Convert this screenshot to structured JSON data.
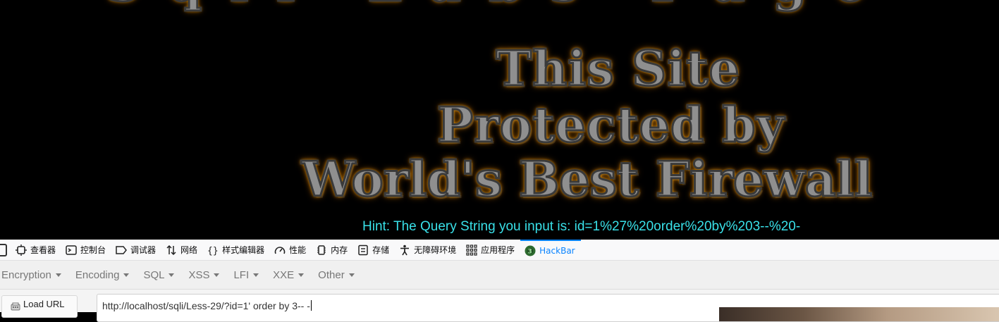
{
  "page": {
    "banner": {
      "top_partial": "Sqli Labs Page",
      "line1": "This Site",
      "line2": "Protected by",
      "line3": "World's Best Firewall"
    },
    "hint": "Hint: The Query String you input is: id=1%27%20order%20by%203--%20-"
  },
  "devtools": {
    "tabs": [
      {
        "label": "查看器",
        "icon": "inspector-icon"
      },
      {
        "label": "控制台",
        "icon": "console-icon"
      },
      {
        "label": "调试器",
        "icon": "debugger-icon"
      },
      {
        "label": "网络",
        "icon": "network-icon"
      },
      {
        "label": "样式编辑器",
        "icon": "style-editor-icon"
      },
      {
        "label": "性能",
        "icon": "performance-icon"
      },
      {
        "label": "内存",
        "icon": "memory-icon"
      },
      {
        "label": "存储",
        "icon": "storage-icon"
      },
      {
        "label": "无障碍环境",
        "icon": "accessibility-icon"
      },
      {
        "label": "应用程序",
        "icon": "application-icon"
      },
      {
        "label": "HackBar",
        "icon": "hackbar-icon"
      }
    ],
    "active_tab": "HackBar",
    "accent_color": "#0a84ff"
  },
  "hackbar": {
    "menu": [
      "Encryption",
      "Encoding",
      "SQL",
      "XSS",
      "LFI",
      "XXE",
      "Other"
    ],
    "load_url_label": "Load URL",
    "url_value": "http://localhost/sqli/Less-29/?id=1' order by 3-- -"
  }
}
